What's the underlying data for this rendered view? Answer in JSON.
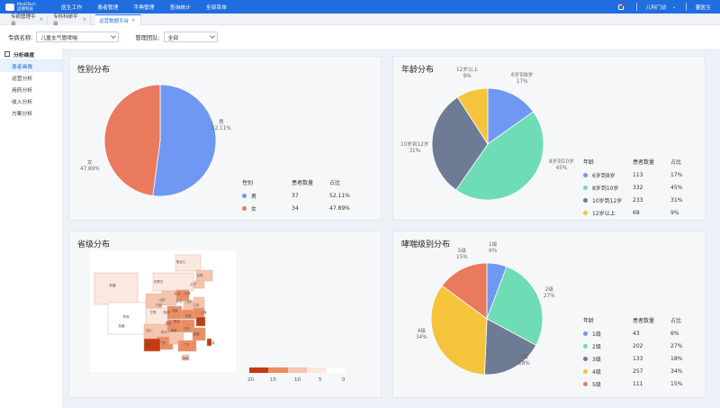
{
  "topbar": {
    "logo_line1": "MediTech",
    "logo_line2": "迈德科技",
    "nav": [
      "医生工作",
      "患者管理",
      "字典管理",
      "查询统计",
      "全部菜单"
    ],
    "dept": "儿科门诊",
    "user": "董医生"
  },
  "tabs": [
    "专病管理平台",
    "专科科研平台",
    "运营数据平台"
  ],
  "filters": {
    "disease_label": "专病名称:",
    "disease_value": "儿童支气管哮喘",
    "team_label": "管理团队:",
    "team_value": "全部"
  },
  "sidebar": {
    "title": "分析维度",
    "items": [
      "患者画像",
      "运营分析",
      "用药分析",
      "收入分析",
      "方案分析"
    ],
    "active_index": 0
  },
  "cards": {
    "gender_title": "性别分布",
    "age_title": "年龄分布",
    "province_title": "省级分布",
    "asthma_title": "哮喘级别分布"
  },
  "legend_headers": {
    "gender": [
      "性别",
      "患者数量",
      "占比"
    ],
    "age": [
      "年龄",
      "患者数量",
      "占比"
    ],
    "asthma": [
      "年龄",
      "患者数量",
      "占比"
    ]
  },
  "gender": [
    {
      "name": "男",
      "count": "37",
      "pct": "52.11%",
      "color": "#6f98f4"
    },
    {
      "name": "女",
      "count": "34",
      "pct": "47.89%",
      "color": "#e97a5e"
    }
  ],
  "age": [
    {
      "name": "6岁到8岁",
      "count": "113",
      "pct": "17%",
      "color": "#6f98f4"
    },
    {
      "name": "8岁到10岁",
      "count": "332",
      "pct": "45%",
      "color": "#6edcb4"
    },
    {
      "name": "10岁到12岁",
      "count": "233",
      "pct": "31%",
      "color": "#6d7b94"
    },
    {
      "name": "12岁以上",
      "count": "68",
      "pct": "9%",
      "color": "#f5c33c"
    }
  ],
  "asthma": [
    {
      "name": "1级",
      "count": "43",
      "pct": "6%",
      "color": "#6f98f4"
    },
    {
      "name": "2级",
      "count": "202",
      "pct": "27%",
      "color": "#6edcb4"
    },
    {
      "name": "3级",
      "count": "133",
      "pct": "18%",
      "color": "#6d7b94"
    },
    {
      "name": "4级",
      "count": "257",
      "pct": "34%",
      "color": "#f5c33c"
    },
    {
      "name": "5级",
      "count": "111",
      "pct": "15%",
      "color": "#e97a5e"
    }
  ],
  "province_scale": {
    "ticks": [
      "20",
      "15",
      "10",
      "5",
      "0"
    ],
    "colors": [
      "#c53a12",
      "#ec8c63",
      "#f6c5ad",
      "#fbe8df",
      "#ffffff"
    ]
  },
  "province_labels": [
    "黑龙江",
    "吉林",
    "辽宁",
    "北京",
    "天津",
    "河北",
    "内蒙古",
    "山西",
    "山东",
    "河南",
    "江苏",
    "安徽",
    "上海",
    "湖北",
    "浙江",
    "湖南",
    "江西",
    "福建",
    "广东",
    "广西",
    "贵州",
    "云南",
    "四川",
    "重庆",
    "陕西",
    "甘肃",
    "宁夏",
    "青海",
    "西藏",
    "新疆",
    "海南",
    "台湾"
  ]
}
